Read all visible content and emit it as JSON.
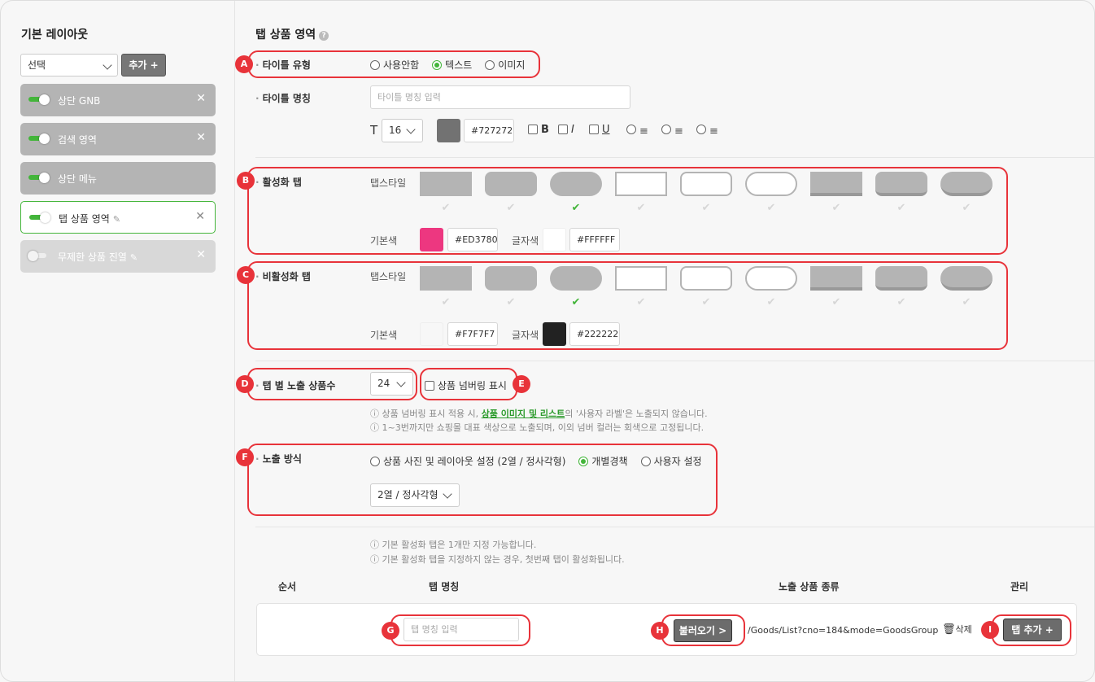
{
  "sidebar": {
    "title": "기본 레이아웃",
    "select_value": "선택",
    "add_label": "추가 +",
    "items": [
      {
        "label": "상단 GNB"
      },
      {
        "label": "검색 영역"
      },
      {
        "label": "상단 메뉴"
      },
      {
        "label": "탭 상품 영역"
      },
      {
        "label": "무제한 상품 진열"
      }
    ]
  },
  "main": {
    "title": "탭 상품 영역",
    "title_type": {
      "label": "타이틀 유형",
      "options": [
        "사용안함",
        "텍스트",
        "이미지"
      ],
      "selected": "텍스트"
    },
    "title_name": {
      "label": "타이틀 명칭",
      "placeholder": "타이틀 명칭 입력",
      "font_size": "16",
      "color_hex": "#727272",
      "bold": "B",
      "italic": "I",
      "underline": "U"
    },
    "active_tab": {
      "label": "활성화 탭",
      "style_label": "탭스타일",
      "base_color_label": "기본색",
      "base_color": "#ED3780",
      "text_color_label": "글자색",
      "text_color": "#FFFFFF"
    },
    "inactive_tab": {
      "label": "비활성화 탭",
      "style_label": "탭스타일",
      "base_color_label": "기본색",
      "base_color": "#F7F7F7",
      "text_color_label": "글자색",
      "text_color": "#222222"
    },
    "count": {
      "label": "탭 별 노출 상품수",
      "value": "24",
      "numbering_label": "상품 넘버링 표시",
      "note1_pre": "ⓘ 상품 넘버링 표시 적용 시, ",
      "note1_link": "상품 이미지 및 리스트",
      "note1_post": "의 '사용자 라벨'은 노출되지 않습니다.",
      "note2": "ⓘ 1~3번까지만 쇼핑몰 대표 색상으로 노출되며, 이외 넘버 컬러는 회색으로 고정됩니다."
    },
    "display": {
      "label": "노출 방식",
      "options": [
        "상품 사진 및 레이아웃 설정 (2열 / 정사각형)",
        "개별경책",
        "사용자 설정"
      ],
      "selected": "개별경책",
      "select_value": "2열 / 정사각형"
    },
    "notes2": [
      "ⓘ 기본 활성화 탭은 1개만 지정 가능합니다.",
      "ⓘ 기본 활성화 탭을 지정하지 않는 경우, 첫번째 탭이 활성화됩니다."
    ],
    "table": {
      "headers": [
        "순서",
        "탭 명칭",
        "노출 상품 종류",
        "관리"
      ],
      "name_placeholder": "탭 명칭 입력",
      "load_label": "불러오기 >",
      "url": "/Goods/List?cno=184&mode=GoodsGroup",
      "delete_label": "삭제",
      "add_tab_label": "탭 추가 +"
    }
  },
  "badges": [
    "A",
    "B",
    "C",
    "D",
    "E",
    "F",
    "G",
    "H",
    "I"
  ],
  "colors": {
    "accent_green": "#43b53a",
    "annotation_red": "#e8333a",
    "swatch_title": "#727272",
    "swatch_active": "#ED3780",
    "swatch_active_text": "#FFFFFF",
    "swatch_inactive": "#F7F7F7",
    "swatch_inactive_text": "#222222"
  }
}
